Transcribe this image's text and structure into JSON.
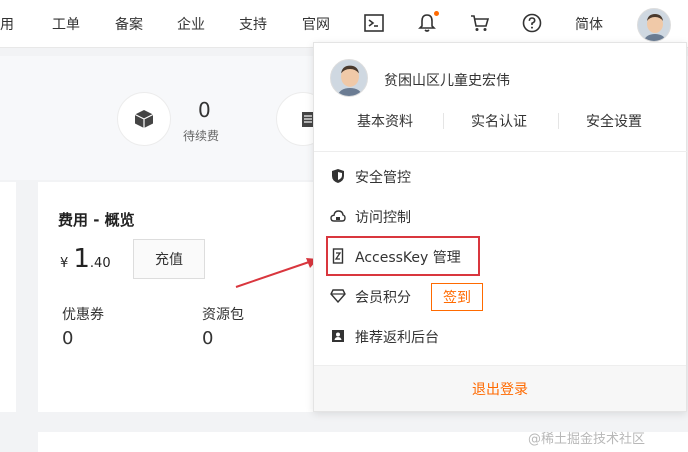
{
  "nav": {
    "items": [
      "费用",
      "工单",
      "备案",
      "企业",
      "支持",
      "官网"
    ],
    "icons": [
      "terminal-icon",
      "bell-icon",
      "cart-icon",
      "help-icon"
    ],
    "lang": "简体",
    "accent": "#ff6a00"
  },
  "summary": {
    "pending_count": "0",
    "pending_label": "待续费"
  },
  "fee_card": {
    "title": "费用 - 概览",
    "currency": "¥",
    "balance_int": "1",
    "balance_dec": ".40",
    "recharge_label": "充值",
    "coupon_label": "优惠券",
    "coupon_value": "0",
    "package_label": "资源包",
    "package_value": "0"
  },
  "dropdown": {
    "username": "贫困山区儿童史宏伟",
    "links": [
      "基本资料",
      "实名认证",
      "安全设置"
    ],
    "menu": [
      {
        "label": "安全管控",
        "icon": "shield-icon"
      },
      {
        "label": "访问控制",
        "icon": "cloud-lock-icon"
      },
      {
        "label": "AccessKey 管理",
        "icon": "key-icon"
      },
      {
        "label": "会员积分",
        "icon": "diamond-icon"
      },
      {
        "label": "推荐返利后台",
        "icon": "referral-icon"
      }
    ],
    "checkin_label": "签到",
    "logout_label": "退出登录",
    "highlight_color": "#d9363e"
  },
  "watermark": "@稀土掘金技术社区"
}
